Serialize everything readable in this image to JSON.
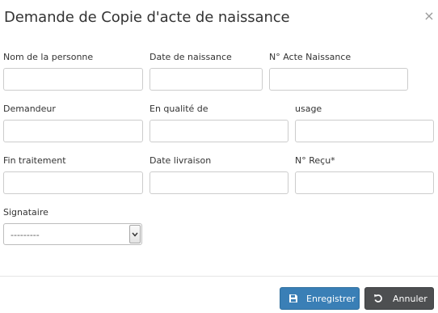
{
  "modal": {
    "title": "Demande de Copie d'acte de naissance",
    "close_symbol": "×"
  },
  "form": {
    "labels": {
      "nom": "Nom de la personne",
      "date_naissance": "Date de naissance",
      "num_acte": "N° Acte Naissance",
      "demandeur": "Demandeur",
      "qualite": "En qualité de",
      "usage": "usage",
      "fin_traitement": "Fin traitement",
      "date_livraison": "Date livraison",
      "num_recu": "N° Reçu*",
      "signataire": "Signataire"
    },
    "values": {
      "nom": "",
      "date_naissance": "",
      "num_acte": "",
      "demandeur": "",
      "qualite": "",
      "usage": "",
      "fin_traitement": "",
      "date_livraison": "",
      "num_recu": ""
    },
    "signataire_selected": "---------"
  },
  "footer": {
    "save_label": "Enregistrer",
    "cancel_label": "Annuler"
  },
  "icons": {
    "close": "close-icon",
    "save": "floppy-disk-icon",
    "cancel": "undo-icon",
    "select_arrow": "chevron-down-icon"
  },
  "colors": {
    "save_button": "#3a7fb6",
    "cancel_button": "#4d4f51",
    "input_border": "#cccccc"
  }
}
